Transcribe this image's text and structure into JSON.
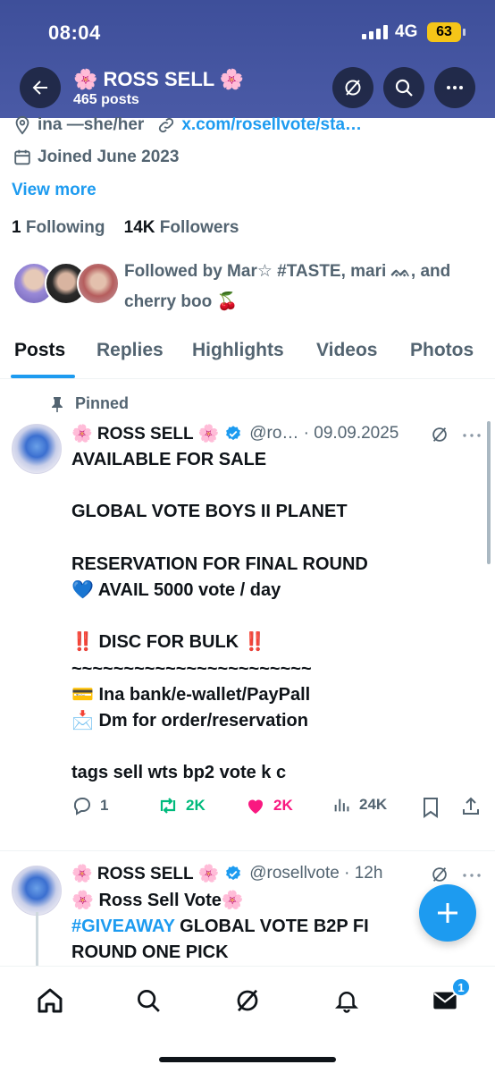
{
  "status_bar": {
    "time": "08:04",
    "network": "4G",
    "battery": "63"
  },
  "header": {
    "title": "🌸 ROSS SELL 🌸",
    "posts_count": "465 posts"
  },
  "profile": {
    "location": "ina —she/her",
    "link": "x.com/rosellvote/sta…",
    "joined": "Joined June 2023",
    "view_more": "View more",
    "following_count": "1",
    "following_label": "Following",
    "followers_count": "14K",
    "followers_label": "Followers",
    "followed_by": "Followed by Mar☆ #TASTE, mari ᨐ, and cherry boo 🍒"
  },
  "tabs": [
    "Posts",
    "Replies",
    "Highlights",
    "Videos",
    "Photos"
  ],
  "pinned_label": "Pinned",
  "posts": [
    {
      "name": "🌸 ROSS SELL 🌸",
      "handle": "@ro… · 09.09.2025",
      "lines": [
        "AVAILABLE FOR SALE",
        "",
        "GLOBAL VOTE BOYS II PLANET",
        "",
        "RESERVATION FOR FINAL ROUND",
        "💙 AVAIL 5000 vote / day",
        "",
        "‼️ DISC FOR BULK ‼️",
        "~~~~~~~~~~~~~~~~~~~~~~~",
        "💳 Ina bank/e-wallet/PayPall",
        "📩 Dm for order/reservation",
        "",
        "tags sell wts bp2 vote k c"
      ],
      "replies": "1",
      "reposts": "2K",
      "likes": "2K",
      "views": "24K"
    },
    {
      "name": "🌸 ROSS SELL 🌸",
      "handle": "@rosellvote · 12h",
      "line1": "🌸 Ross Sell Vote🌸",
      "hashtag": "#GIVEAWAY",
      "line2_rest": " GLOBAL VOTE B2P FI",
      "line3": "ROUND ONE PICK"
    }
  ],
  "bottom_nav": {
    "messages_badge": "1"
  },
  "colors": {
    "accent": "#1d9bf0",
    "repost": "#00ba7c",
    "like": "#f91880",
    "header_bg": "#4a5aa6"
  }
}
